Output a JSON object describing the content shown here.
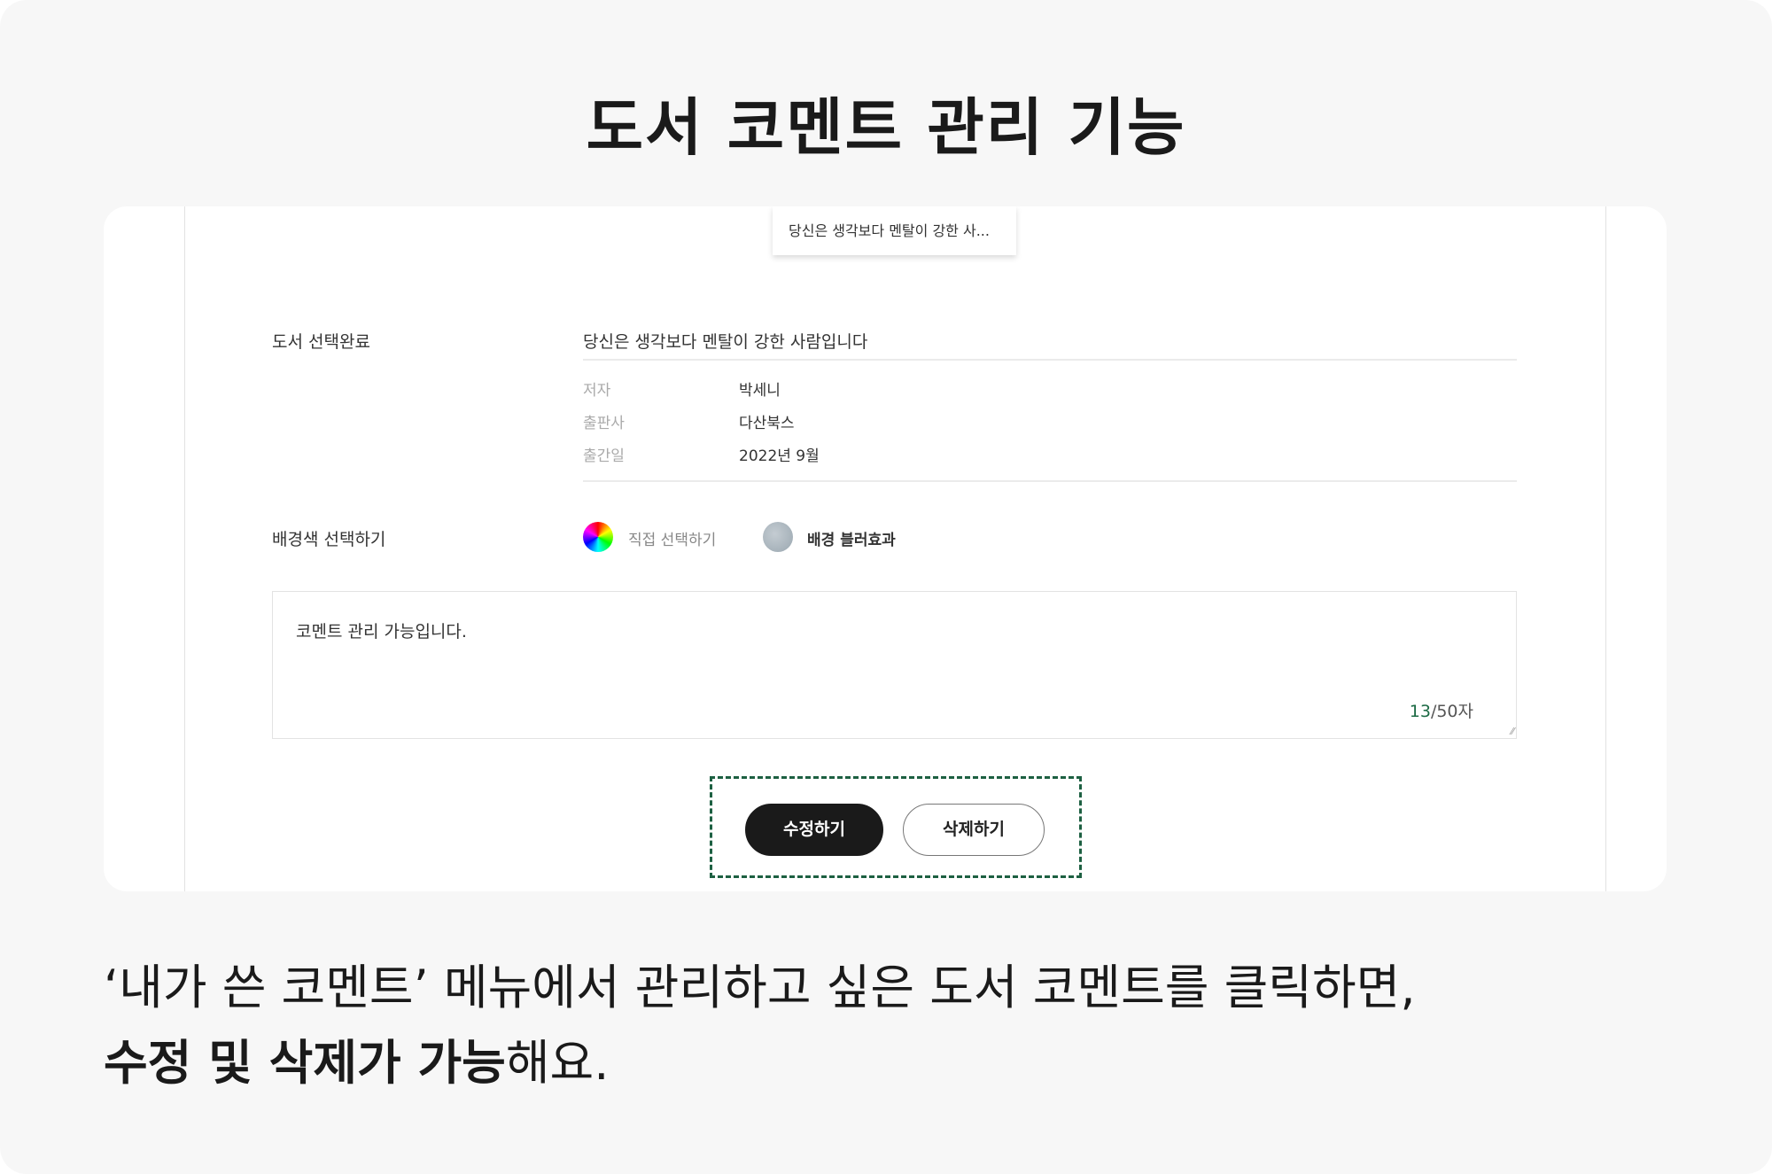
{
  "page_title": "도서 코멘트 관리 기능",
  "tooltip": "당신은 생각보다 멘탈이 강한 사...",
  "book": {
    "label": "도서 선택완료",
    "title": "당신은 생각보다 멘탈이 강한 사람입니다",
    "details": [
      {
        "key": "저자",
        "value": "박세니"
      },
      {
        "key": "출판사",
        "value": "다산북스"
      },
      {
        "key": "출간일",
        "value": "2022년 9월"
      }
    ]
  },
  "background": {
    "label": "배경색 선택하기",
    "custom_label": "직접 선택하기",
    "blur_label": "배경 블러효과"
  },
  "comment": {
    "value": "코멘트 관리 가능입니다.",
    "count": "13",
    "max": "/50자"
  },
  "buttons": {
    "edit": "수정하기",
    "delete": "삭제하기"
  },
  "caption": {
    "line1": "‘내가 쓴 코멘트’ 메뉴에서 관리하고 싶은 도서 코멘트를 클릭하면,",
    "line2_bold": "수정 및 삭제가 가능",
    "line2_rest": "해요."
  },
  "colors": {
    "accent": "#1d6042",
    "button_dark": "#1a1a1a",
    "background": "#f7f7f7"
  }
}
